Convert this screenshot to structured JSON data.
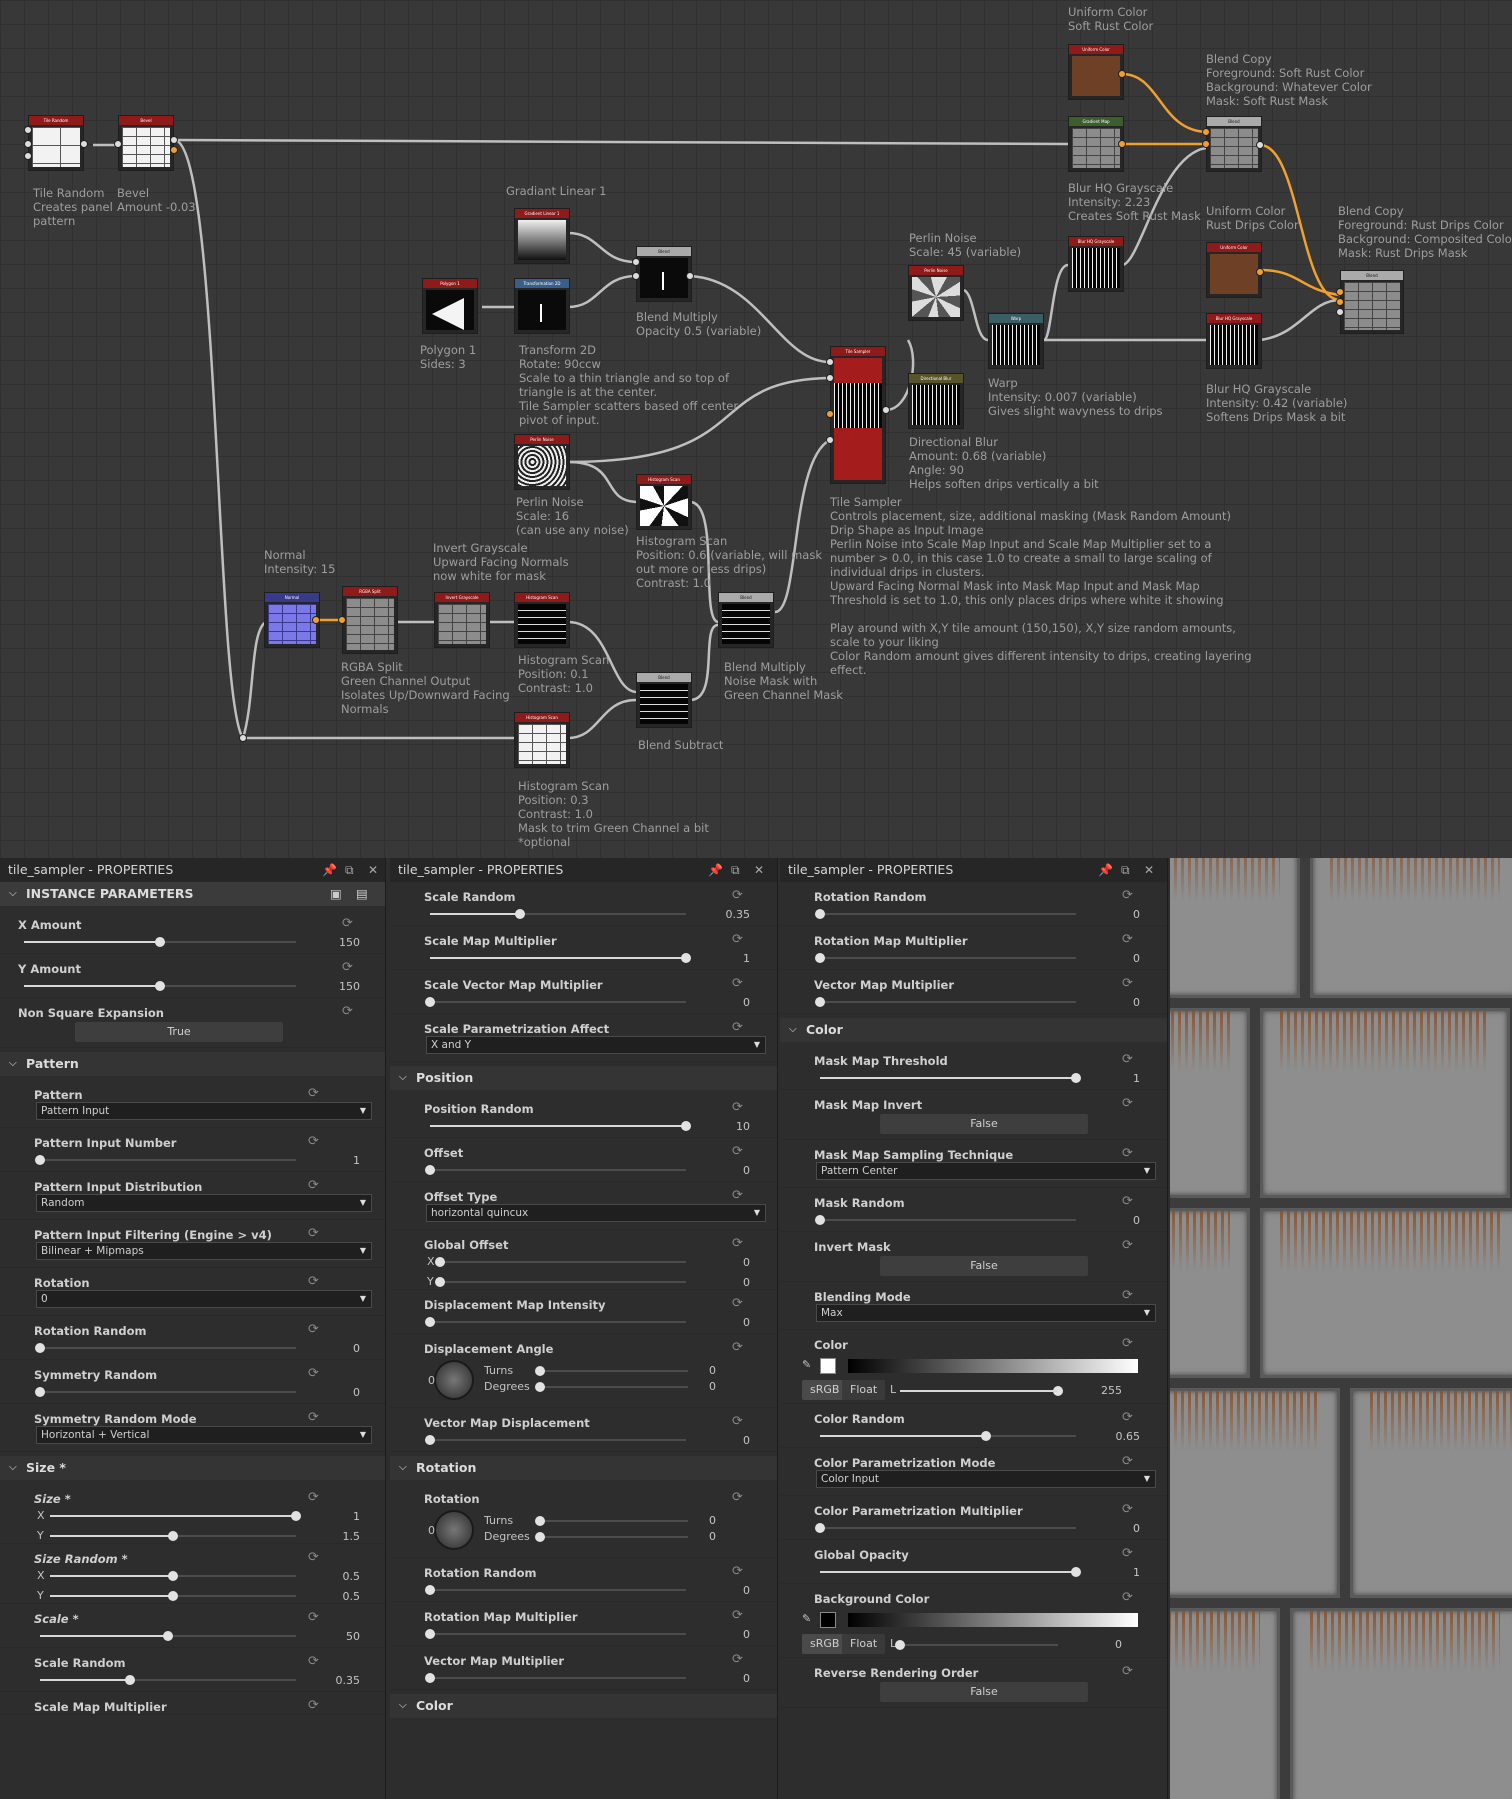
{
  "graph": {
    "nodes": {
      "tile_random": {
        "header": "Tile Random",
        "label": [
          "Tile Random",
          "Creates panel",
          "pattern"
        ]
      },
      "bevel": {
        "header": "Bevel",
        "label": [
          "Bevel",
          "Amount -0.03"
        ]
      },
      "gradient_linear": {
        "header": "Gradient Linear 1",
        "label": [
          "Gradiant Linear 1"
        ]
      },
      "polygon": {
        "header": "Polygon 1",
        "label": [
          "Polygon 1",
          "Sides: 3"
        ]
      },
      "transform": {
        "header": "Transformation 2D",
        "label": [
          "Transform 2D",
          "Rotate: 90ccw",
          "Scale to a thin triangle and so top of",
          "triangle is at the center.",
          "Tile Sampler scatters based off center",
          "pivot of input."
        ]
      },
      "blend_multiply": {
        "header": "Blend",
        "label": [
          "Blend Multiply",
          "Opacity 0.5 (variable)"
        ]
      },
      "perlin1": {
        "header": "Perlin Noise",
        "label": [
          "Perlin Noise",
          "Scale: 16",
          "(can use any noise)"
        ]
      },
      "hist1": {
        "header": "Histogram Scan",
        "label": [
          "Histogram Scan",
          "Position: 0.6 (variable, will mask",
          "out more or less drips)",
          "Contrast: 1.0"
        ]
      },
      "tile_sampler": {
        "header": "Tile Sampler",
        "label": [
          "Tile Sampler",
          "Controls placement, size, additional masking (Mask Random Amount)",
          "Drip Shape as Input Image",
          "Perlin Noise  into Scale Map Input and Scale Map Multiplier set to a",
          "number > 0.0, in this case 1.0 to create a small to large scaling of",
          "individual drips in clusters.",
          "Upward Facing Normal Mask into Mask Map Input and Mask Map",
          "Threshold  is set to 1.0, this only places drips where white it showing",
          "",
          "Play around with  X,Y tile amount (150,150),  X,Y size random amounts,",
          "scale to your liking",
          "Color Random amount gives different intensity to drips, creating layering",
          "effect."
        ]
      },
      "perlin2": {
        "header": "Perlin Noise",
        "label": [
          "Perlin Noise",
          "Scale: 45 (variable)"
        ]
      },
      "dir_blur": {
        "header": "Directional Blur",
        "label": [
          "Directional Blur",
          "Amount: 0.68 (variable)",
          "Angle: 90",
          "Helps soften drips vertically a bit"
        ]
      },
      "warp": {
        "header": "Warp",
        "label": [
          "Warp",
          "Intensity: 0.007 (variable)",
          "Gives slight wavyness to drips"
        ]
      },
      "uniform1": {
        "header": "Uniform Color",
        "label": [
          "Uniform Color",
          "Soft Rust Color"
        ]
      },
      "blur1": {
        "header": "Gradient Map",
        "label": [
          "Blur HQ Grayscale",
          "Intensity: 2.23",
          "Creates Soft Rust Mask"
        ]
      },
      "blur_top": {
        "header": "Blur HQ Grayscale",
        "label": []
      },
      "blend_copy1": {
        "header": "Blend",
        "label": [
          "Blend Copy",
          "Foreground: Soft Rust Color",
          "Background: Whatever Color",
          "Mask: Soft Rust Mask"
        ]
      },
      "uniform2": {
        "header": "Uniform Color",
        "label": [
          "Uniform Color",
          "Rust Drips Color"
        ]
      },
      "blur2": {
        "header": "Blur HQ Grayscale",
        "label": [
          "Blur HQ Grayscale",
          "Intensity: 0.42 (variable)",
          "Softens Drips Mask a bit"
        ]
      },
      "blend_copy2": {
        "header": "Blend",
        "label": [
          "Blend Copy",
          "Foreground: Rust Drips Color",
          "Background: Composited Color",
          "Mask: Rust Drips Mask"
        ]
      },
      "normal": {
        "header": "Normal",
        "label": [
          "Normal",
          "Intensity: 15"
        ]
      },
      "rgba_split": {
        "header": "RGBA Split",
        "label": [
          "RGBA Split",
          "Green Channel Output",
          "Isolates Up/Downward Facing",
          "Normals"
        ]
      },
      "invert": {
        "header": "Invert Grayscale",
        "label": [
          "Invert Grayscale",
          "Upward Facing Normals",
          "now white for mask"
        ]
      },
      "hist2": {
        "header": "Histogram Scan",
        "label": [
          "Histogram Scan",
          "Position: 0.1",
          "Contrast: 1.0"
        ]
      },
      "blend_mult2": {
        "header": "Blend",
        "label": [
          "Blend Multiply",
          "Noise Mask with",
          "Green Channel Mask"
        ]
      },
      "blend_sub": {
        "header": "Blend",
        "label": [
          "Blend Subtract"
        ]
      },
      "hist3": {
        "header": "Histogram Scan",
        "label": [
          "Histogram Scan",
          "Position: 0.3",
          "Contrast: 1.0",
          "Mask to trim Green Channel a bit",
          "*optional"
        ]
      }
    }
  },
  "panel1": {
    "title": "tile_sampler - PROPERTIES",
    "section": "INSTANCE PARAMETERS",
    "x_amount": {
      "label": "X Amount",
      "value": "150",
      "fraction": 0.5
    },
    "y_amount": {
      "label": "Y Amount",
      "value": "150",
      "fraction": 0.5
    },
    "nse": {
      "label": "Non Square Expansion",
      "value": "True"
    },
    "pattern_sec": "Pattern",
    "pattern": {
      "label": "Pattern",
      "value": "Pattern Input"
    },
    "pin": {
      "label": "Pattern Input Number",
      "value": "1",
      "fraction": 0.0
    },
    "pid": {
      "label": "Pattern Input Distribution",
      "value": "Random"
    },
    "pif": {
      "label": "Pattern Input Filtering (Engine > v4)",
      "value": "Bilinear + Mipmaps"
    },
    "rotation": {
      "label": "Rotation",
      "value": "0"
    },
    "rot_random": {
      "label": "Rotation Random",
      "value": "0",
      "fraction": 0.0
    },
    "sym_random": {
      "label": "Symmetry Random",
      "value": "0",
      "fraction": 0.0
    },
    "sym_mode": {
      "label": "Symmetry Random Mode",
      "value": "Horizontal + Vertical"
    },
    "size_sec": "Size *",
    "size": {
      "label": "Size *",
      "x": "1",
      "y": "1.5",
      "xf": 1.0,
      "yf": 0.5
    },
    "size_random": {
      "label": "Size Random *",
      "x": "0.5",
      "y": "0.5",
      "xf": 0.5,
      "yf": 0.5
    },
    "scale": {
      "label": "Scale *",
      "value": "50",
      "fraction": 0.5
    },
    "scale_random": {
      "label": "Scale Random",
      "value": "0.35",
      "fraction": 0.35
    },
    "scale_map_mult": {
      "label": "Scale Map Multiplier"
    },
    "axis_x": "X",
    "axis_y": "Y"
  },
  "panel2": {
    "title": "tile_sampler - PROPERTIES",
    "scale_random": {
      "label": "Scale Random",
      "value": "0.35",
      "fraction": 0.35
    },
    "scale_map_mult": {
      "label": "Scale Map Multiplier",
      "value": "1",
      "fraction": 1.0
    },
    "svmm": {
      "label": "Scale Vector Map Multiplier",
      "value": "0",
      "fraction": 0.0
    },
    "spa": {
      "label": "Scale Parametrization Affect",
      "value": "X and Y"
    },
    "position_sec": "Position",
    "pos_random": {
      "label": "Position Random",
      "value": "10",
      "fraction": 1.0
    },
    "offset": {
      "label": "Offset",
      "value": "0",
      "fraction": 0.0
    },
    "offset_type": {
      "label": "Offset Type",
      "value": "horizontal quincux"
    },
    "global_offset": {
      "label": "Global Offset",
      "x": "0",
      "y": "0"
    },
    "dmi": {
      "label": "Displacement Map Intensity",
      "value": "0",
      "fraction": 0.0
    },
    "disp_angle": {
      "label": "Displacement Angle",
      "turns": "0",
      "degrees": "0",
      "dial": "0"
    },
    "vmd": {
      "label": "Vector Map Displacement",
      "value": "0",
      "fraction": 0.0
    },
    "rotation_sec": "Rotation",
    "rotation": {
      "label": "Rotation",
      "turns": "0",
      "degrees": "0",
      "dial": "0"
    },
    "rot_random": {
      "label": "Rotation Random",
      "value": "0",
      "fraction": 0.0
    },
    "rmm": {
      "label": "Rotation Map Multiplier",
      "value": "0",
      "fraction": 0.0
    },
    "vmm": {
      "label": "Vector Map Multiplier",
      "value": "0",
      "fraction": 0.0
    },
    "color_sec": "Color",
    "turns": "Turns",
    "degrees": "Degrees",
    "axis_x": "X",
    "axis_y": "Y"
  },
  "panel3": {
    "title": "tile_sampler - PROPERTIES",
    "rot_random": {
      "label": "Rotation Random",
      "value": "0",
      "fraction": 0.0
    },
    "rmm": {
      "label": "Rotation Map Multiplier",
      "value": "0",
      "fraction": 0.0
    },
    "vmm": {
      "label": "Vector Map Multiplier",
      "value": "0",
      "fraction": 0.0
    },
    "color_sec": "Color",
    "mmt": {
      "label": "Mask Map Threshold",
      "value": "1",
      "fraction": 1.0
    },
    "mmi": {
      "label": "Mask Map Invert",
      "value": "False"
    },
    "mmst": {
      "label": "Mask Map Sampling Technique",
      "value": "Pattern Center"
    },
    "mask_random": {
      "label": "Mask Random",
      "value": "0",
      "fraction": 0.0
    },
    "invert_mask": {
      "label": "Invert Mask",
      "value": "False"
    },
    "blend_mode": {
      "label": "Blending Mode",
      "value": "Max"
    },
    "color": {
      "label": "Color",
      "srgb": "sRGB",
      "float": "Float",
      "l": "L",
      "value": "255",
      "fraction": 1.0,
      "swatch": "#ffffff"
    },
    "color_random": {
      "label": "Color Random",
      "value": "0.65",
      "fraction": 0.65
    },
    "cpm": {
      "label": "Color Parametrization Mode",
      "value": "Color Input"
    },
    "cpmult": {
      "label": "Color Parametrization Multiplier",
      "value": "0",
      "fraction": 0.0
    },
    "global_opacity": {
      "label": "Global Opacity",
      "value": "1",
      "fraction": 1.0
    },
    "bg_color": {
      "label": "Background Color",
      "srgb": "sRGB",
      "float": "Float",
      "l": "L",
      "value": "0",
      "fraction": 0.0,
      "swatch": "#000000"
    },
    "rro": {
      "label": "Reverse Rendering Order",
      "value": "False"
    }
  },
  "colors": {
    "accent": "#f0a030",
    "node_header": "#8e1a1a",
    "rust": "#8a5532"
  }
}
